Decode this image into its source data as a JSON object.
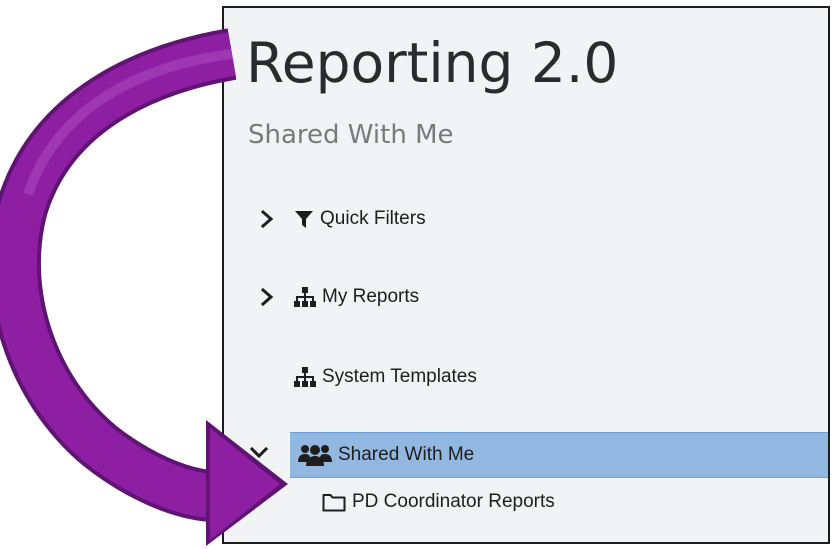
{
  "header": {
    "title": "Reporting 2.0",
    "subtitle": "Shared With Me"
  },
  "tree": {
    "items": [
      {
        "label": "Quick Filters",
        "icon": "filter-icon",
        "expandable": true,
        "expanded": false
      },
      {
        "label": "My Reports",
        "icon": "sitemap-icon",
        "expandable": true,
        "expanded": false
      },
      {
        "label": "System Templates",
        "icon": "sitemap-icon",
        "expandable": false
      },
      {
        "label": "Shared With Me",
        "icon": "users-icon",
        "expandable": true,
        "expanded": true,
        "selected": true
      },
      {
        "label": "PD Coordinator Reports",
        "icon": "folder-icon",
        "expandable": false,
        "child": true
      }
    ]
  },
  "colors": {
    "selection": "#92b8e2",
    "arrow": "#8e1fa3",
    "panel_background": "#f2f3f5"
  }
}
